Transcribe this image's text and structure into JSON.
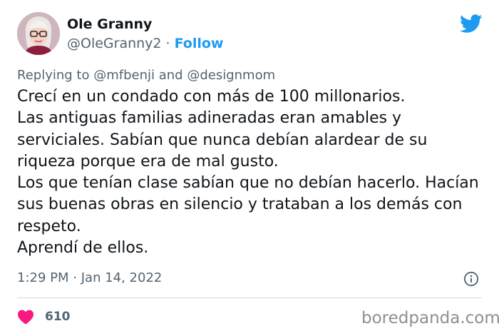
{
  "author": {
    "display_name": "Ole Granny",
    "handle": "@OleGranny2",
    "separator": "·",
    "follow_label": "Follow",
    "avatar_icon": "avatar-grandma-glasses"
  },
  "brand": {
    "icon": "twitter-bird-icon",
    "color": "#1d9bf0"
  },
  "reply_context": {
    "prefix": "Replying to",
    "mention_1": "@mfbenji",
    "conjunction": "and",
    "mention_2": "@designmom"
  },
  "tweet": {
    "text": "Crecí en un condado con más de 100 millonarios.\nLas antiguas familias adineradas eran amables y serviciales. Sabían que nunca debían alardear de su riqueza porque era de mal gusto.\nLos que tenían clase sabían que no debían hacerlo. Hacían sus buenas obras en silencio y trataban a los demás con respeto.\nAprendí de ellos.",
    "time": "1:29 PM",
    "separator": "·",
    "date": "Jan 14, 2022",
    "info_icon": "info-icon"
  },
  "engagement": {
    "likes": "610",
    "like_icon": "heart-icon",
    "like_color": "#f91880"
  },
  "watermark": {
    "text": "boredpanda.com"
  }
}
